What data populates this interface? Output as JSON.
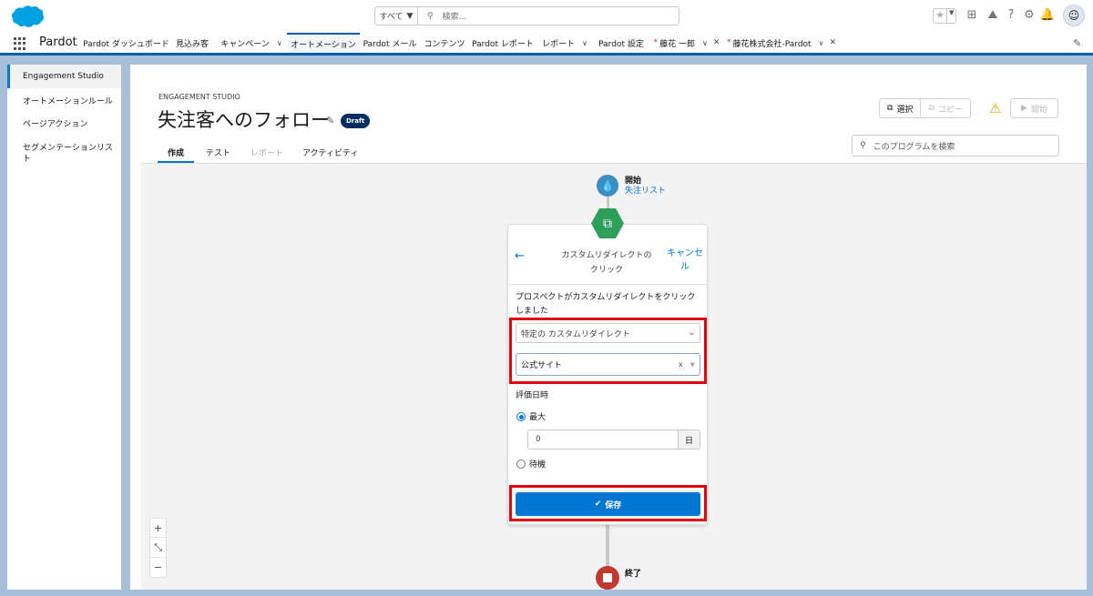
{
  "header": {
    "scope": "すべて",
    "search_placeholder": "検索..."
  },
  "nav": {
    "app_name": "Pardot",
    "items": [
      "Pardot ダッシュボード",
      "見込み客",
      "キャンペーン",
      "オートメーション",
      "Pardot メール",
      "コンテンツ",
      "Pardot レポート",
      "レポート",
      "Pardot 設定",
      "藤花 一郎",
      "藤花株式会社-Pardot"
    ]
  },
  "sidebar": {
    "items": [
      "Engagement Studio",
      "オートメーションルール",
      "ページアクション",
      "セグメンテーションリスト"
    ]
  },
  "page": {
    "eyebrow": "ENGAGEMENT STUDIO",
    "title": "失注客へのフォロー",
    "badge": "Draft",
    "tabs": [
      "作成",
      "テスト",
      "レポート",
      "アクティビティ"
    ],
    "actions": {
      "select": "選択",
      "copy": "コピー",
      "start": "開始"
    },
    "search_placeholder": "このプログラムを検索"
  },
  "flow": {
    "start_label": "開始",
    "start_list": "失注リスト",
    "end_label": "終了"
  },
  "panel": {
    "title": "カスタムリダイレクトのクリック",
    "cancel": "キャンセル",
    "description": "プロスペクトがカスタムリダイレクトをクリックしました",
    "select_type": "特定の カスタムリダイレクト",
    "select_value": "公式サイト",
    "eval_label": "評価日時",
    "option_max": "最大",
    "days_value": "0",
    "days_unit": "日",
    "option_wait": "待機",
    "save": "保存"
  },
  "colors": {
    "brand": "#0176d3",
    "nav_accent": "#0b5cab",
    "highlight": "#e3000f",
    "draft": "#032d60"
  }
}
